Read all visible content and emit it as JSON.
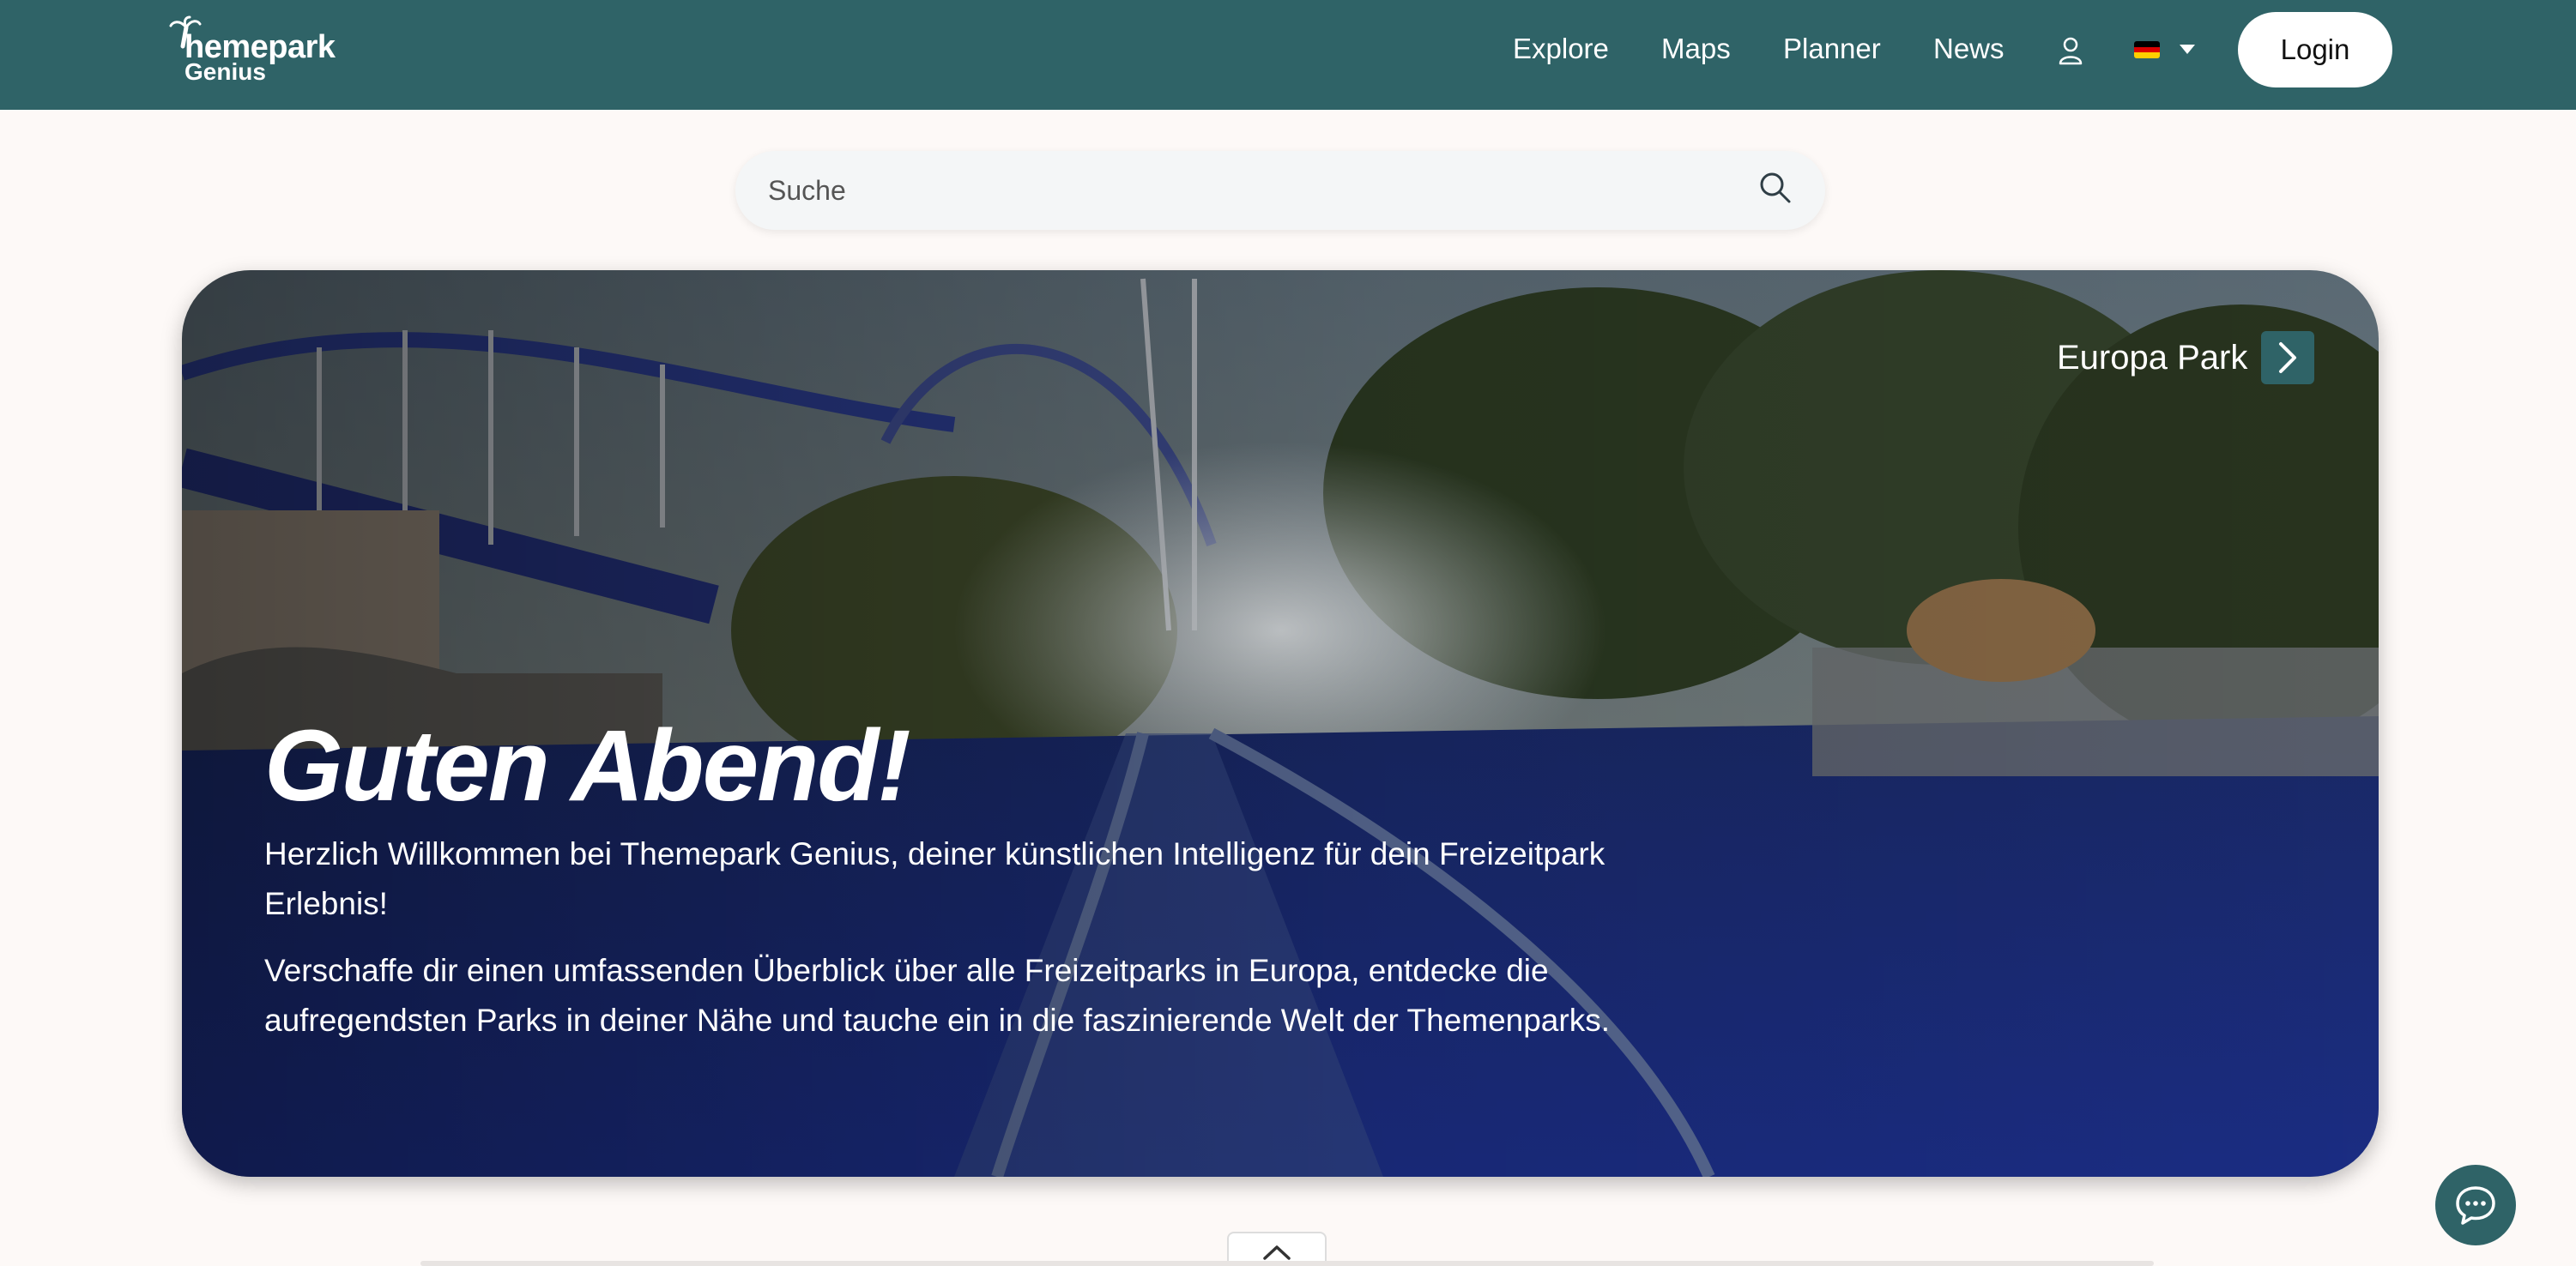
{
  "header": {
    "logo_line1": "hemepark",
    "logo_line2": "Genius",
    "nav": [
      "Explore",
      "Maps",
      "Planner",
      "News"
    ],
    "login_label": "Login",
    "language_flag": "de-flag-icon"
  },
  "search": {
    "placeholder": "Suche"
  },
  "hero": {
    "park_name": "Europa Park",
    "greeting": "Guten Abend!",
    "intro": "Herzlich Willkommen bei Themepark Genius, deiner künstlichen Intelligenz für dein Freizeitpark Erlebnis!",
    "intro2": "Verschaffe dir einen umfassenden Überblick über alle Freizeitparks in Europa, entdecke die aufregendsten Parks in deiner Nähe und tauche ein in die faszinierende Welt der Themenparks."
  },
  "colors": {
    "brand": "#2f6367",
    "background": "#fdf9f7"
  }
}
